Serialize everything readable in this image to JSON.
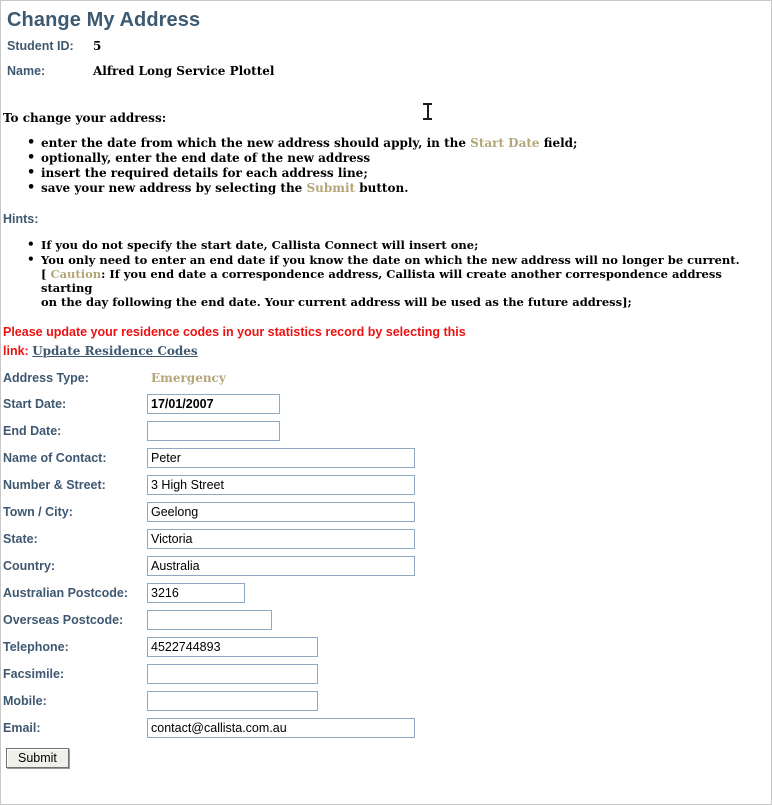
{
  "header": {
    "title": "Change My Address",
    "student_id_label": "Student ID:",
    "student_id_value": "5",
    "name_label": "Name:",
    "name_value": "Alfred Long Service Plottel"
  },
  "instructions": {
    "intro": "To change your address:",
    "items": [
      {
        "pre": "enter the date from which the new address should apply, in the ",
        "highlight": "Start Date",
        "post": " field;"
      },
      {
        "pre": "optionally, enter the end date of the new address",
        "highlight": "",
        "post": ""
      },
      {
        "pre": "insert the required details for each address line;",
        "highlight": "",
        "post": ""
      },
      {
        "pre": "save your new address by selecting the ",
        "highlight": "Submit",
        "post": " button."
      }
    ]
  },
  "hints": {
    "title": "Hints:",
    "item1": "If you do not specify the start date, Callista Connect will insert one;",
    "item2_line1": "You only need to enter an end date if you know the date on which the new address will no longer be current.",
    "item2_bracket_open": "[ ",
    "item2_caution": "Caution",
    "item2_line2": ": If you end date a correspondence address, Callista will create another correspondence address starting",
    "item2_line3": "on the day following the end date. Your current address will be used as the future address];"
  },
  "notice": {
    "line1": "Please update your residence codes in your statistics record by selecting this",
    "line2_prefix": "link:",
    "link_text": "Update Residence Codes"
  },
  "form": {
    "address_type": {
      "label": "Address Type:",
      "value": "Emergency"
    },
    "fields": [
      {
        "label": "Start Date:",
        "value": "17/01/2007",
        "placeholder": ""
      },
      {
        "label": "End Date:",
        "value": "",
        "placeholder": ""
      },
      {
        "label": "Name of Contact:",
        "value": "Peter",
        "placeholder": ""
      },
      {
        "label": "Number & Street:",
        "value": "3 High Street",
        "placeholder": ""
      },
      {
        "label": "Town / City:",
        "value": "Geelong",
        "placeholder": ""
      },
      {
        "label": "State:",
        "value": "Victoria",
        "placeholder": ""
      },
      {
        "label": "Country:",
        "value": "Australia",
        "placeholder": ""
      },
      {
        "label": "Australian Postcode:",
        "value": "3216",
        "placeholder": ""
      },
      {
        "label": "Overseas Postcode:",
        "value": "",
        "placeholder": ""
      },
      {
        "label": "Telephone:",
        "value": "4522744893",
        "placeholder": ""
      },
      {
        "label": "Facsimile:",
        "value": "",
        "placeholder": ""
      },
      {
        "label": "Mobile:",
        "value": "",
        "placeholder": ""
      },
      {
        "label": "Email:",
        "value": "contact@callista.com.au",
        "placeholder": ""
      }
    ],
    "submit_label": "Submit"
  },
  "colors": {
    "title": "#3d5a70",
    "label": "#3f5871",
    "accent_tan": "#b5a678",
    "alert_red": "#ee1111",
    "input_border": "#8fa9c4"
  }
}
